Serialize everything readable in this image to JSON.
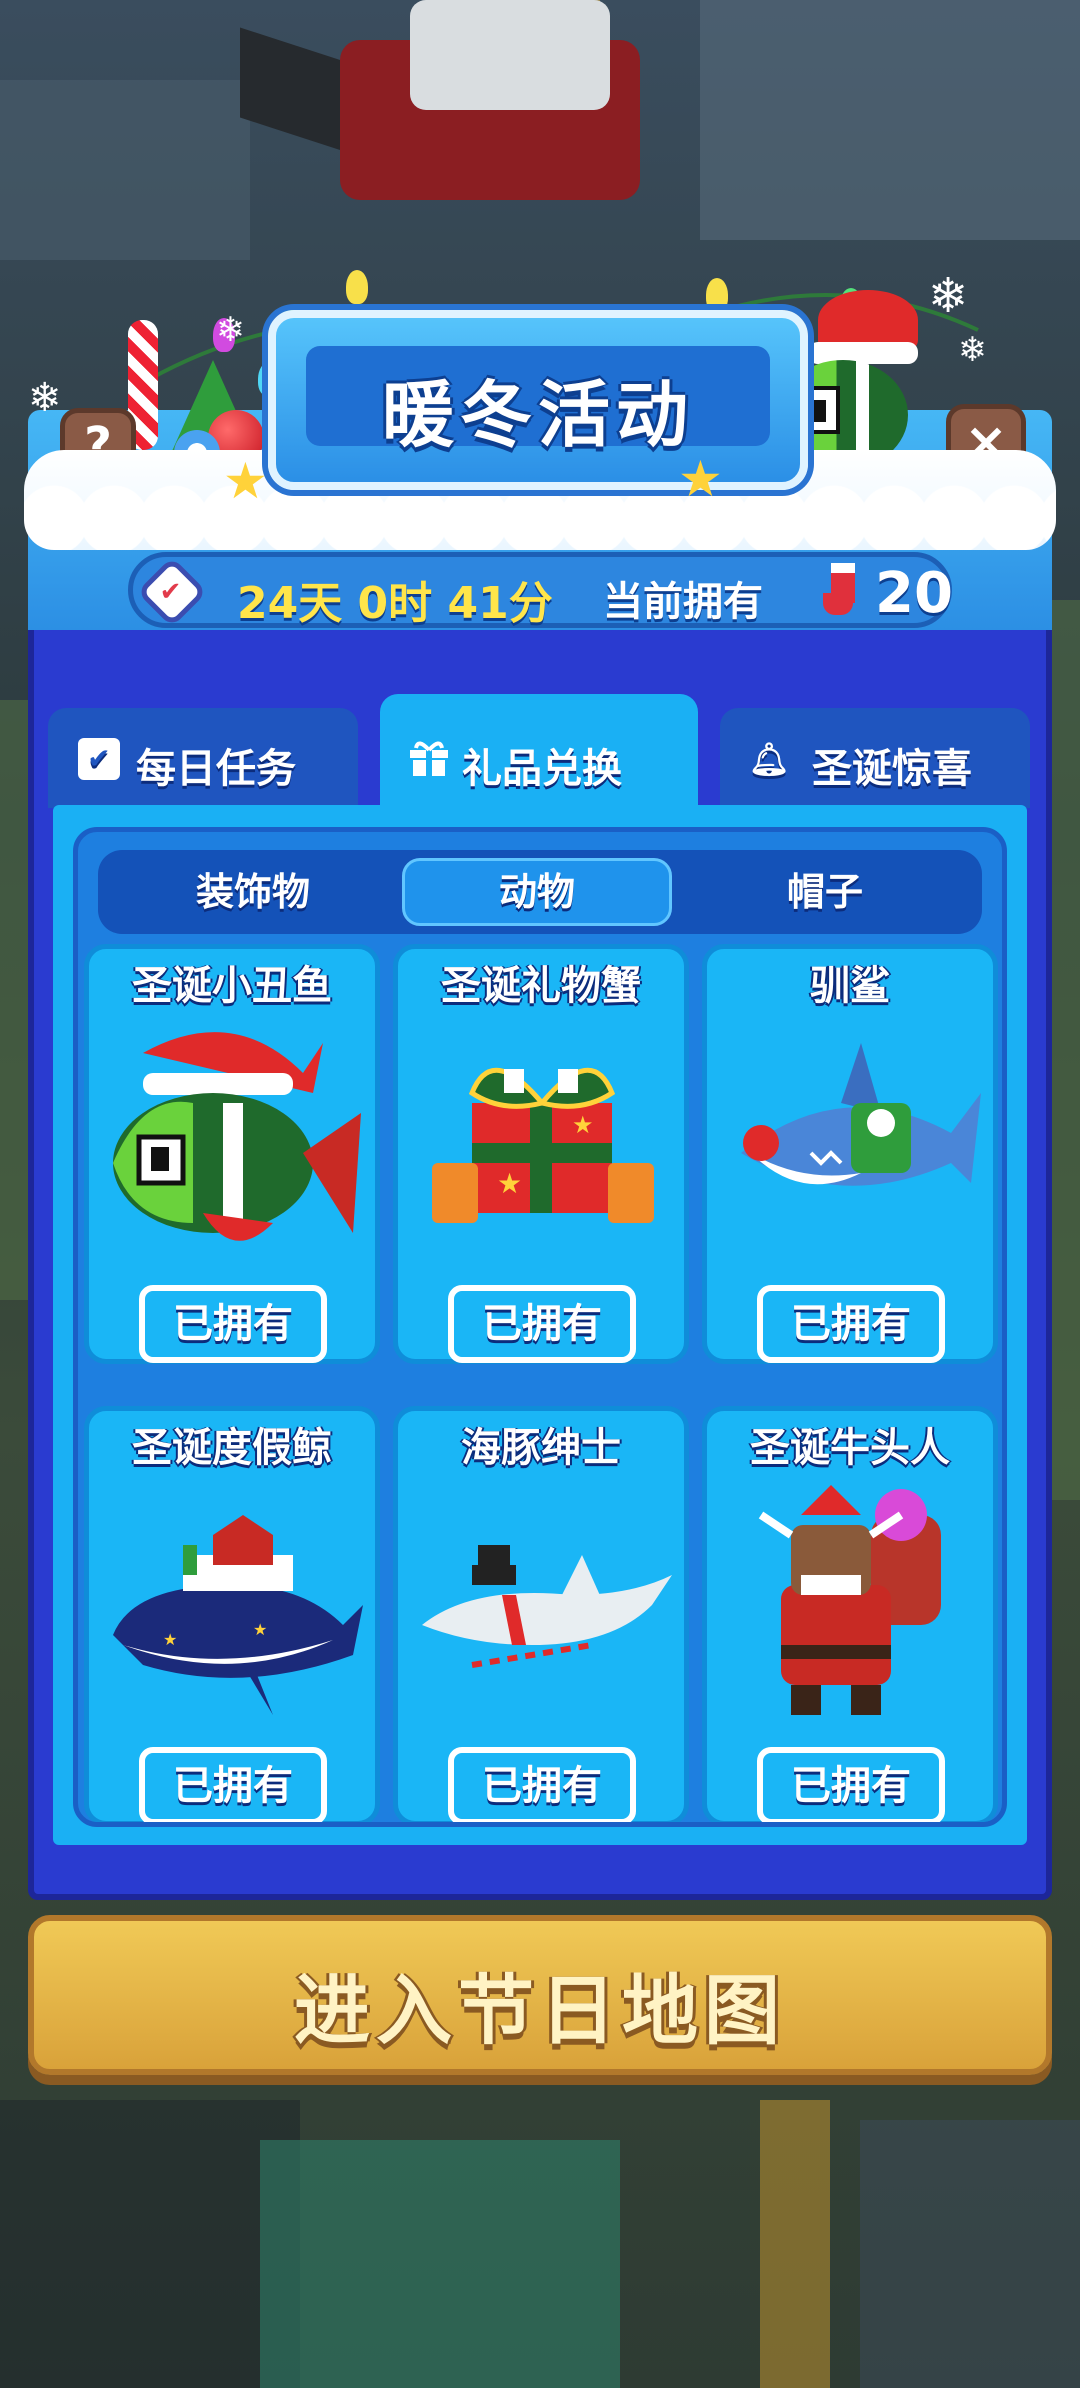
{
  "header": {
    "title": "暖冬活动"
  },
  "status": {
    "timer": "24天 0时 41分",
    "owned_label": "当前拥有",
    "owned_count": "20"
  },
  "buttons": {
    "help": "?",
    "close": "×"
  },
  "tabs": [
    {
      "label": "每日任务",
      "icon": "checkbox-icon"
    },
    {
      "label": "礼品兑换",
      "icon": "gift-icon",
      "active": true
    },
    {
      "label": "圣诞惊喜",
      "icon": "bell-icon"
    }
  ],
  "subtabs": [
    {
      "label": "装饰物"
    },
    {
      "label": "动物",
      "active": true
    },
    {
      "label": "帽子"
    }
  ],
  "items": [
    {
      "name": "圣诞小丑鱼",
      "status": "已拥有"
    },
    {
      "name": "圣诞礼物蟹",
      "status": "已拥有"
    },
    {
      "name": "驯鲨",
      "status": "已拥有"
    },
    {
      "name": "圣诞度假鲸",
      "status": "已拥有"
    },
    {
      "name": "海豚绅士",
      "status": "已拥有"
    },
    {
      "name": "圣诞牛头人",
      "status": "已拥有"
    }
  ],
  "enter_map": {
    "label": "进入节日地图"
  },
  "colors": {
    "panel_blue": "#2a3bd0",
    "sky_blue": "#1ab0f4",
    "gold": "#e8bb4c",
    "timer_yellow": "#ffe54a"
  }
}
